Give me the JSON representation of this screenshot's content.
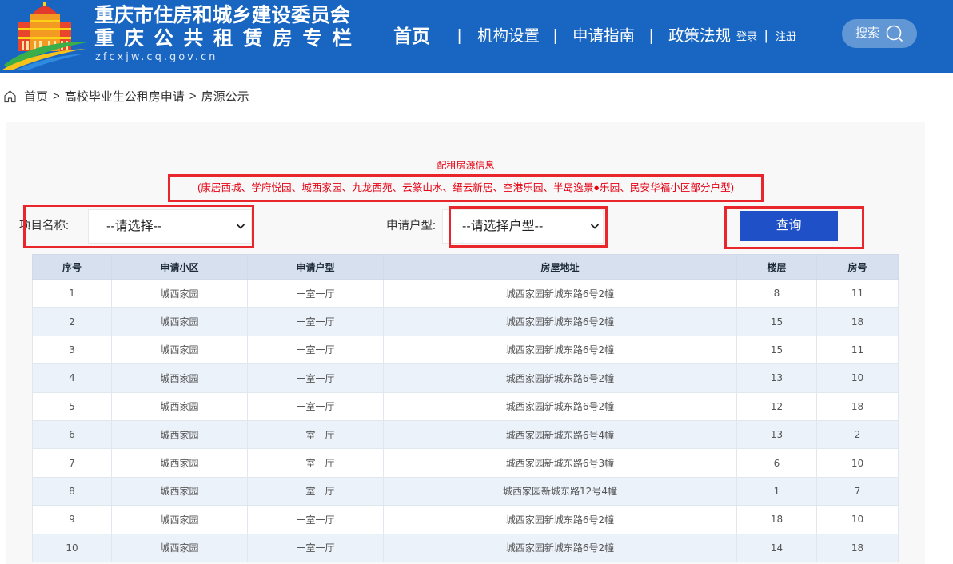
{
  "header": {
    "title_line1": "重庆市住房和城乡建设委员会",
    "title_line2": "重庆公共租赁房专栏",
    "domain": "zfcxjw.cq.gov.cn",
    "nav": [
      {
        "label": "首页"
      },
      {
        "label": "机构设置"
      },
      {
        "label": "申请指南"
      },
      {
        "label": "政策法规"
      }
    ],
    "separator": "|",
    "login": "登录",
    "register": "注册",
    "search_label": "搜索"
  },
  "breadcrumb": {
    "items": [
      "首页",
      "高校毕业生公租房申请",
      "房源公示"
    ],
    "separator": ">"
  },
  "panel": {
    "title": "配租房源信息",
    "subtitle": "(康居西城、学府悦园、城西家园、九龙西苑、云篆山水、缙云新居、空港乐园、半岛逸景●乐园、民安华福小区部分户型)"
  },
  "filters": {
    "project_label": "项目名称:",
    "project_value": "--请选择--",
    "type_label": "申请户型:",
    "type_value": "--请选择户型--",
    "query_button": "查询"
  },
  "table": {
    "columns": [
      "序号",
      "申请小区",
      "申请户型",
      "房屋地址",
      "楼层",
      "房号"
    ],
    "rows": [
      [
        "1",
        "城西家园",
        "一室一厅",
        "城西家园新城东路6号2幢",
        "8",
        "11"
      ],
      [
        "2",
        "城西家园",
        "一室一厅",
        "城西家园新城东路6号2幢",
        "15",
        "18"
      ],
      [
        "3",
        "城西家园",
        "一室一厅",
        "城西家园新城东路6号2幢",
        "15",
        "11"
      ],
      [
        "4",
        "城西家园",
        "一室一厅",
        "城西家园新城东路6号2幢",
        "13",
        "10"
      ],
      [
        "5",
        "城西家园",
        "一室一厅",
        "城西家园新城东路6号2幢",
        "12",
        "18"
      ],
      [
        "6",
        "城西家园",
        "一室一厅",
        "城西家园新城东路6号4幢",
        "13",
        "2"
      ],
      [
        "7",
        "城西家园",
        "一室一厅",
        "城西家园新城东路6号3幢",
        "6",
        "10"
      ],
      [
        "8",
        "城西家园",
        "一室一厅",
        "城西家园新城东路12号4幢",
        "1",
        "7"
      ],
      [
        "9",
        "城西家园",
        "一室一厅",
        "城西家园新城东路6号2幢",
        "18",
        "10"
      ],
      [
        "10",
        "城西家园",
        "一室一厅",
        "城西家园新城东路6号2幢",
        "14",
        "18"
      ]
    ]
  },
  "icons": {
    "logo": "building-logo-icon",
    "home": "home-icon",
    "search": "search-icon",
    "dropdown": "chevron-down-icon"
  },
  "colors": {
    "header_bg": "#1866c2",
    "accent_red": "#e60012",
    "highlight_red": "#e8262b",
    "button_bg": "#1f50c7",
    "table_header_bg": "#d6e0ee",
    "row_alt_bg": "#ecf2fa",
    "panel_bg": "#f8f8f8"
  }
}
